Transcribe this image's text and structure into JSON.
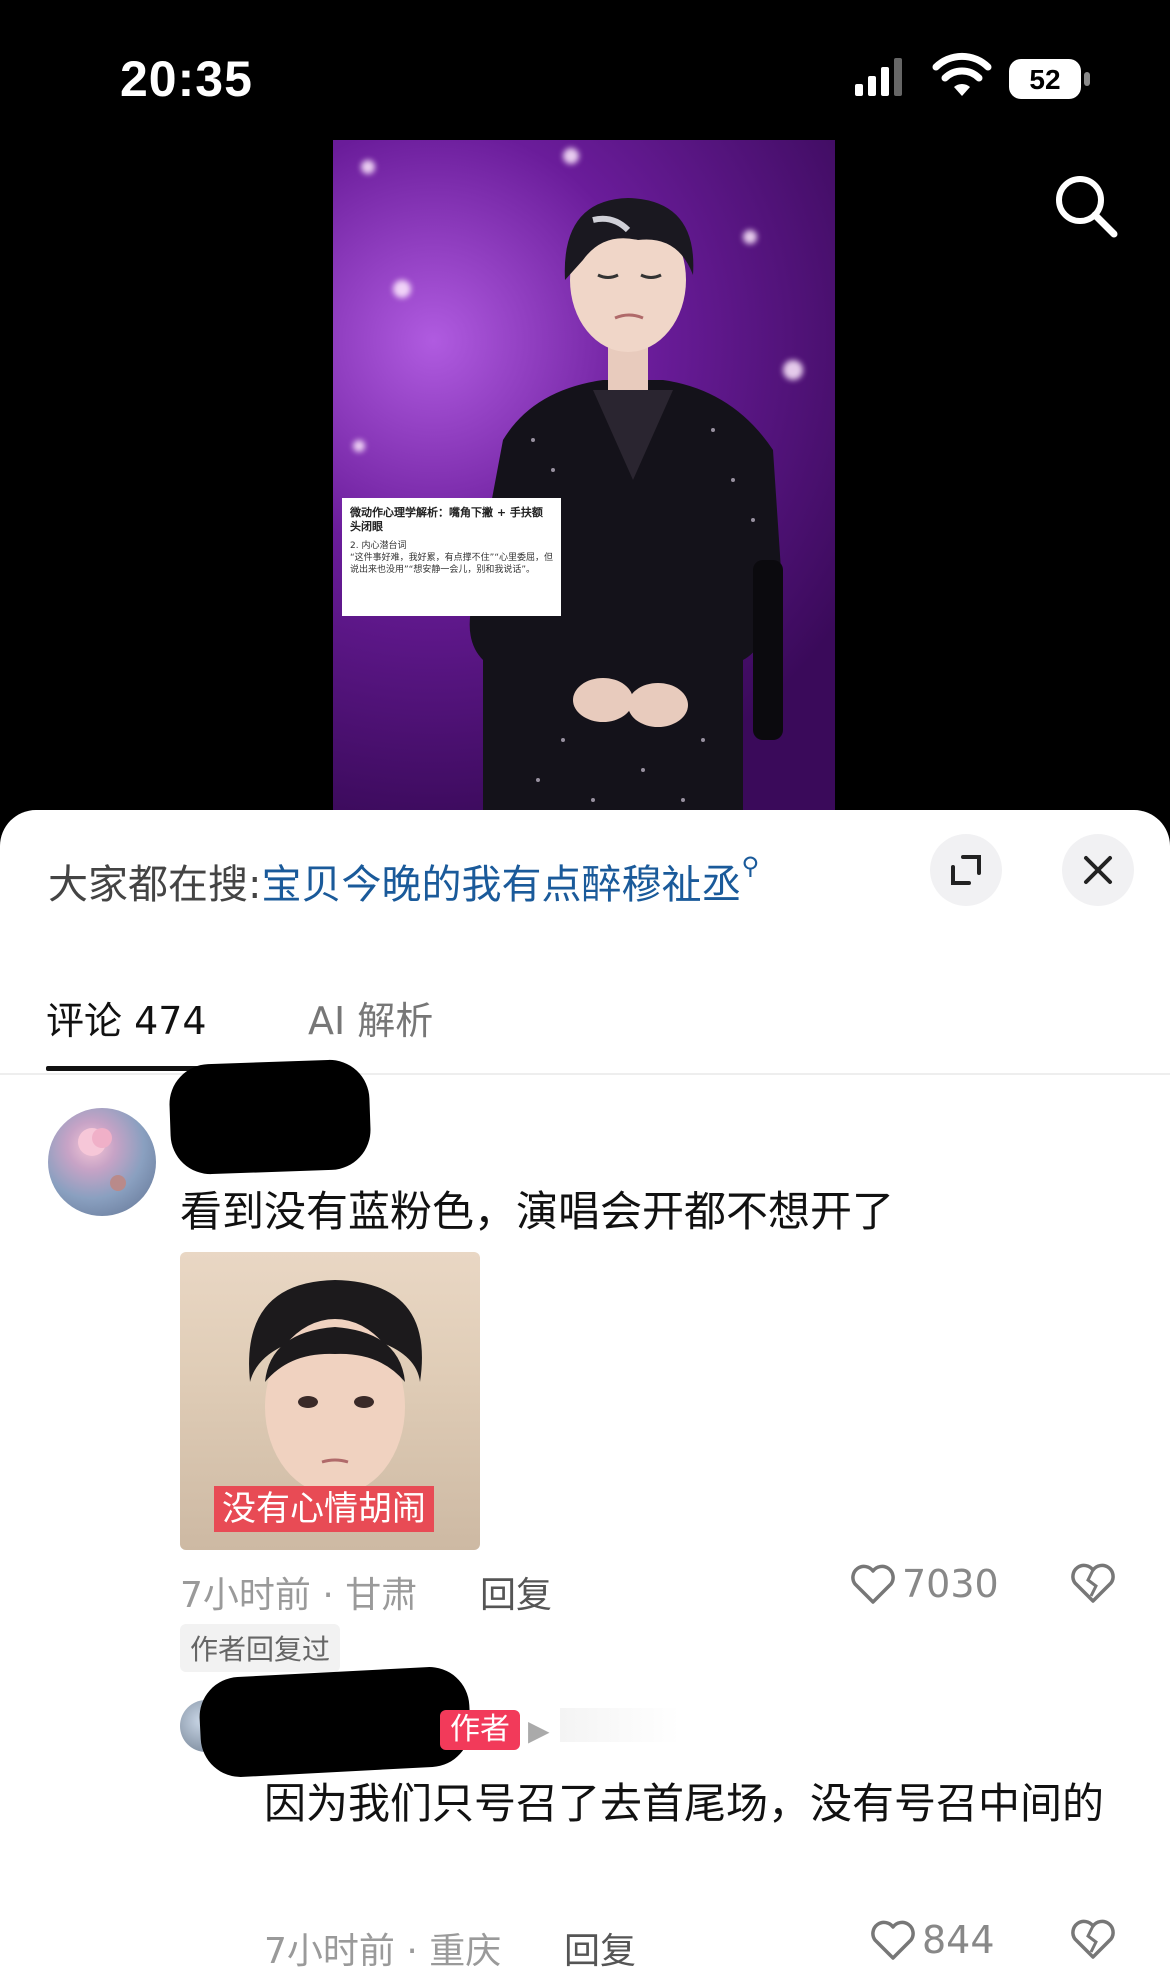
{
  "status_bar": {
    "time": "20:35",
    "battery": "52"
  },
  "video": {
    "caption_title": "微动作心理学解析：嘴角下撇 + 手扶额头闭眼",
    "caption_body": "2. 内心潜台词\n“这件事好难，我好累，有点撑不住”“心里委屈，但说出来也没用”“想安静一会儿，别和我说话”。"
  },
  "search_hint": {
    "prefix": "大家都在搜:",
    "query": "宝贝今晚的我有点醉穆祉丞"
  },
  "tabs": [
    {
      "label": "评论 474",
      "active": true
    },
    {
      "label": "AI 解析",
      "active": false
    }
  ],
  "comment": {
    "text": "看到没有蓝粉色，演唱会开都不想开了",
    "image_caption": "没有心情胡闹",
    "meta": "7小时前 · 甘肃",
    "reply_label": "回复",
    "likes": "7030",
    "author_replied": "作者回复过"
  },
  "reply": {
    "badge": "作者",
    "text": "因为我们只号召了去首尾场，没有号召中间的",
    "meta": "7小时前 · 重庆",
    "reply_label": "回复",
    "likes": "844"
  },
  "colors": {
    "accent_query": "#1a5a9a",
    "author_badge": "#f23a5a",
    "image_caption_bg": "#e84b55"
  }
}
